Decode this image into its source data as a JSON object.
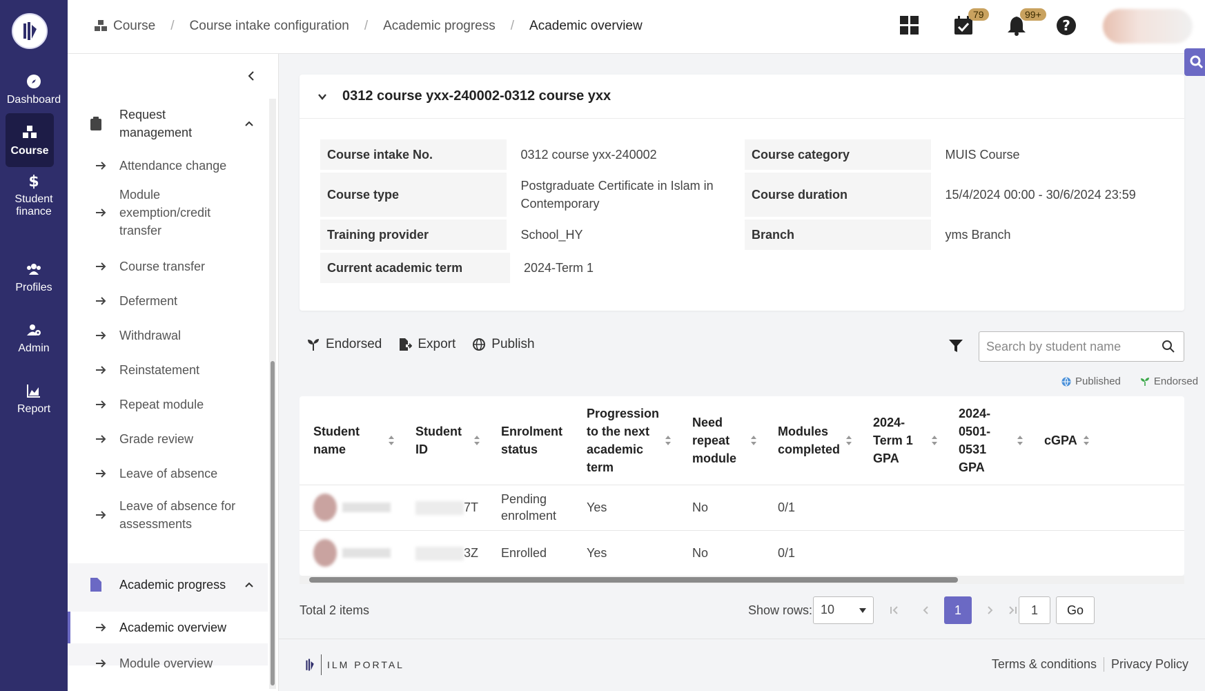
{
  "rail": {
    "items": [
      {
        "label": "Dashboard",
        "icon": "compass-icon"
      },
      {
        "label": "Course",
        "icon": "cubes-icon"
      },
      {
        "label": "Student finance",
        "icon": "dollar-icon"
      },
      {
        "label": "Profiles",
        "icon": "users-icon"
      },
      {
        "label": "Admin",
        "icon": "user-gear-icon"
      },
      {
        "label": "Report",
        "icon": "chart-icon"
      }
    ]
  },
  "breadcrumb": [
    "Course",
    "Course intake configuration",
    "Academic progress",
    "Academic overview"
  ],
  "topbar": {
    "calendar_badge": "79",
    "bell_badge": "99+"
  },
  "subnav": {
    "group1": "Request management",
    "items1": [
      "Attendance change",
      "Module exemption/credit transfer",
      "Course transfer",
      "Deferment",
      "Withdrawal",
      "Reinstatement",
      "Repeat module",
      "Grade review",
      "Leave of absence",
      "Leave of absence for assessments"
    ],
    "group2": "Academic progress",
    "items2": [
      "Academic overview",
      "Module overview"
    ]
  },
  "card": {
    "title": "0312 course yxx-240002-0312 course yxx",
    "rows": [
      {
        "k1": "Course intake No.",
        "v1": "0312 course yxx-240002",
        "k2": "Course category",
        "v2": "MUIS Course"
      },
      {
        "k1": "Course type",
        "v1": "Postgraduate Certificate in Islam in Contemporary",
        "k2": "Course duration",
        "v2": "15/4/2024 00:00 - 30/6/2024 23:59"
      },
      {
        "k1": "Training provider",
        "v1": "School_HY",
        "k2": "Branch",
        "v2": "yms Branch"
      },
      {
        "k1": "Current academic term",
        "v1": "2024-Term 1",
        "k2": "",
        "v2": ""
      }
    ]
  },
  "toolbar": {
    "endorsed": "Endorsed",
    "export": "Export",
    "publish": "Publish",
    "search_placeholder": "Search by student name"
  },
  "legend": {
    "published": "Published",
    "endorsed": "Endorsed"
  },
  "table": {
    "headers": [
      "Student name",
      "Student ID",
      "Enrolment status",
      "Progression to the next academic term",
      "Need repeat module",
      "Modules completed",
      "2024-Term 1 GPA",
      "2024-0501-0531 GPA",
      "cGPA"
    ],
    "rows": [
      {
        "id_suffix": "7T",
        "status": "Pending enrolment",
        "progression": "Yes",
        "repeat": "No",
        "modules": "0/1"
      },
      {
        "id_suffix": "3Z",
        "status": "Enrolled",
        "progression": "Yes",
        "repeat": "No",
        "modules": "0/1"
      }
    ]
  },
  "pagination": {
    "total": "Total 2 items",
    "show_rows": "Show rows:",
    "rows_value": "10",
    "current": "1",
    "goto_value": "1",
    "go": "Go"
  },
  "footer": {
    "brand": "ILM PORTAL",
    "terms": "Terms & conditions",
    "privacy": "Privacy Policy"
  },
  "colors": {
    "rail": "#2f2e6b",
    "accent": "#6b69c4",
    "badge": "#c9a25f"
  }
}
